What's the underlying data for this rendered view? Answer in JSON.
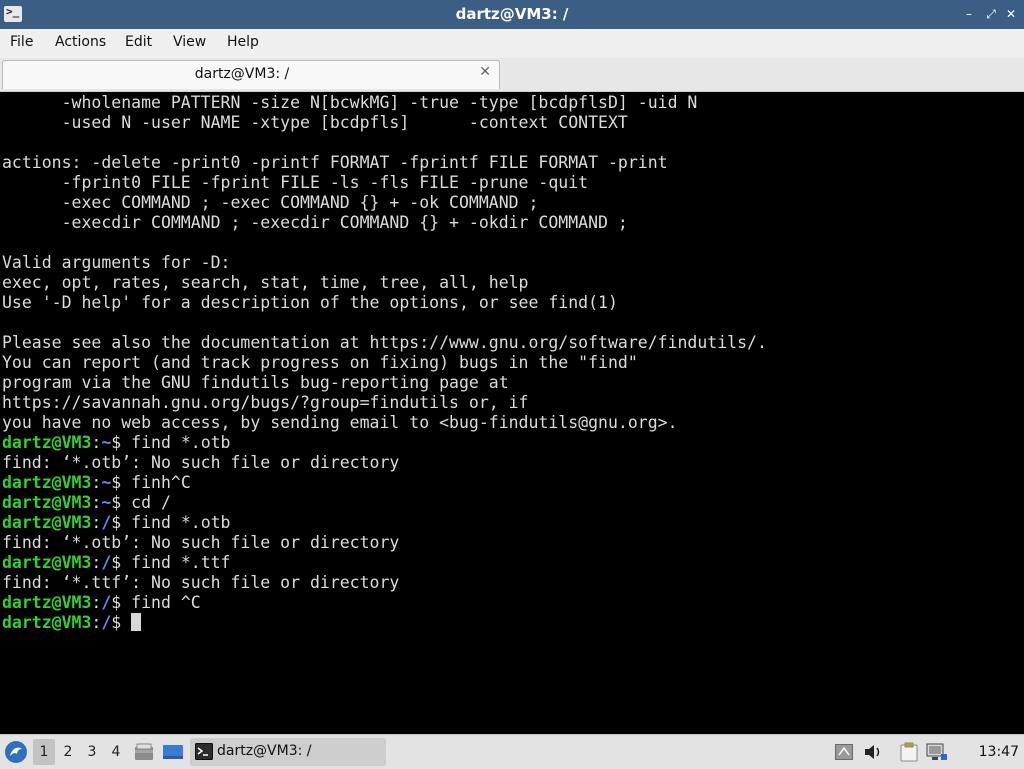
{
  "window": {
    "title": "dartz@VM3: /",
    "app_icon_glyph": ">_",
    "controls": {
      "minimize": "–",
      "maximize": "⤢",
      "close": "✕"
    }
  },
  "menubar": {
    "items": [
      "File",
      "Actions",
      "Edit",
      "View",
      "Help"
    ]
  },
  "tabs": [
    {
      "title": "dartz@VM3: /",
      "close_glyph": "✕"
    }
  ],
  "terminal": {
    "colors": {
      "text": "#dcdcdc",
      "prompt_user": "#33d033",
      "prompt_path": "#5c8fff",
      "background": "#000000"
    },
    "lines": [
      {
        "text": "      -wholename PATTERN -size N[bcwkMG] -true -type [bcdpflsD] -uid N"
      },
      {
        "text": "      -used N -user NAME -xtype [bcdpfls]      -context CONTEXT"
      },
      {
        "text": ""
      },
      {
        "text": "actions: -delete -print0 -printf FORMAT -fprintf FILE FORMAT -print"
      },
      {
        "text": "      -fprint0 FILE -fprint FILE -ls -fls FILE -prune -quit"
      },
      {
        "text": "      -exec COMMAND ; -exec COMMAND {} + -ok COMMAND ;"
      },
      {
        "text": "      -execdir COMMAND ; -execdir COMMAND {} + -okdir COMMAND ;"
      },
      {
        "text": ""
      },
      {
        "text": "Valid arguments for -D:"
      },
      {
        "text": "exec, opt, rates, search, stat, time, tree, all, help"
      },
      {
        "text": "Use '-D help' for a description of the options, or see find(1)"
      },
      {
        "text": ""
      },
      {
        "text": "Please see also the documentation at https://www.gnu.org/software/findutils/."
      },
      {
        "text": "You can report (and track progress on fixing) bugs in the \"find\""
      },
      {
        "text": "program via the GNU findutils bug-reporting page at"
      },
      {
        "text": "https://savannah.gnu.org/bugs/?group=findutils or, if"
      },
      {
        "text": "you have no web access, by sending email to <bug-findutils@gnu.org>."
      },
      {
        "prompt": {
          "user": "dartz@VM3",
          "sep": ":",
          "path": "~",
          "symbol": "$ "
        },
        "text": "find *.otb"
      },
      {
        "text": "find: ‘*.otb’: No such file or directory"
      },
      {
        "prompt": {
          "user": "dartz@VM3",
          "sep": ":",
          "path": "~",
          "symbol": "$ "
        },
        "text": "finh^C"
      },
      {
        "prompt": {
          "user": "dartz@VM3",
          "sep": ":",
          "path": "~",
          "symbol": "$ "
        },
        "text": "cd /"
      },
      {
        "prompt": {
          "user": "dartz@VM3",
          "sep": ":",
          "path": "/",
          "symbol": "$ "
        },
        "text": "find *.otb"
      },
      {
        "text": "find: ‘*.otb’: No such file or directory"
      },
      {
        "prompt": {
          "user": "dartz@VM3",
          "sep": ":",
          "path": "/",
          "symbol": "$ "
        },
        "text": "find *.ttf"
      },
      {
        "text": "find: ‘*.ttf’: No such file or directory"
      },
      {
        "prompt": {
          "user": "dartz@VM3",
          "sep": ":",
          "path": "/",
          "symbol": "$ "
        },
        "text": "find ^C"
      },
      {
        "prompt": {
          "user": "dartz@VM3",
          "sep": ":",
          "path": "/",
          "symbol": "$ "
        },
        "text": "",
        "cursor": true
      }
    ]
  },
  "taskbar": {
    "start_icon": "start-menu-icon",
    "workspaces": [
      "1",
      "2",
      "3",
      "4"
    ],
    "active_workspace": "1",
    "launchers": [
      "file-manager-icon",
      "show-desktop-icon"
    ],
    "task": {
      "label": "dartz@VM3: /",
      "icon": "terminal-icon"
    },
    "tray_icons": [
      "keyboard-layout-icon",
      "volume-icon",
      "clipboard-icon",
      "network-icon"
    ],
    "clock": "13:47"
  }
}
